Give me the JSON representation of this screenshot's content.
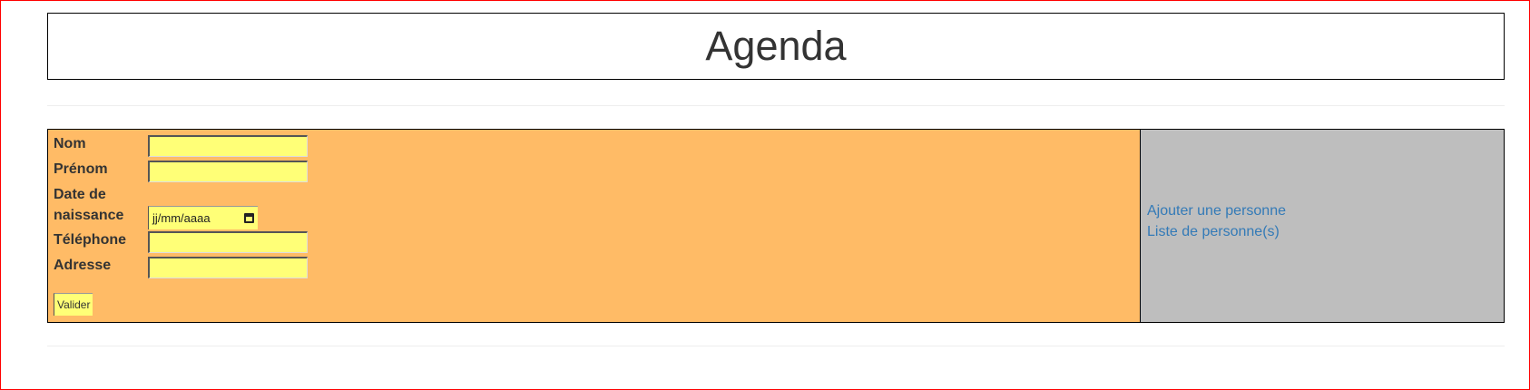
{
  "header": {
    "title": "Agenda"
  },
  "form": {
    "fields": {
      "nom": {
        "label": "Nom",
        "value": ""
      },
      "prenom": {
        "label": "Prénom",
        "value": ""
      },
      "date_naissance": {
        "label_line1": "Date de",
        "label_line2": "naissance",
        "placeholder": "jj/mm/aaaa"
      },
      "telephone": {
        "label": "Téléphone",
        "value": ""
      },
      "adresse": {
        "label": "Adresse",
        "value": ""
      }
    },
    "submit_label": "Valider"
  },
  "side_nav": {
    "links": [
      {
        "label": "Ajouter une personne"
      },
      {
        "label": "Liste de personne(s)"
      }
    ]
  },
  "colors": {
    "form_bg": "#ffbb66",
    "input_bg": "#ffff77",
    "side_bg": "#bebebe",
    "link": "#337ab7",
    "page_border": "#ff0000"
  }
}
